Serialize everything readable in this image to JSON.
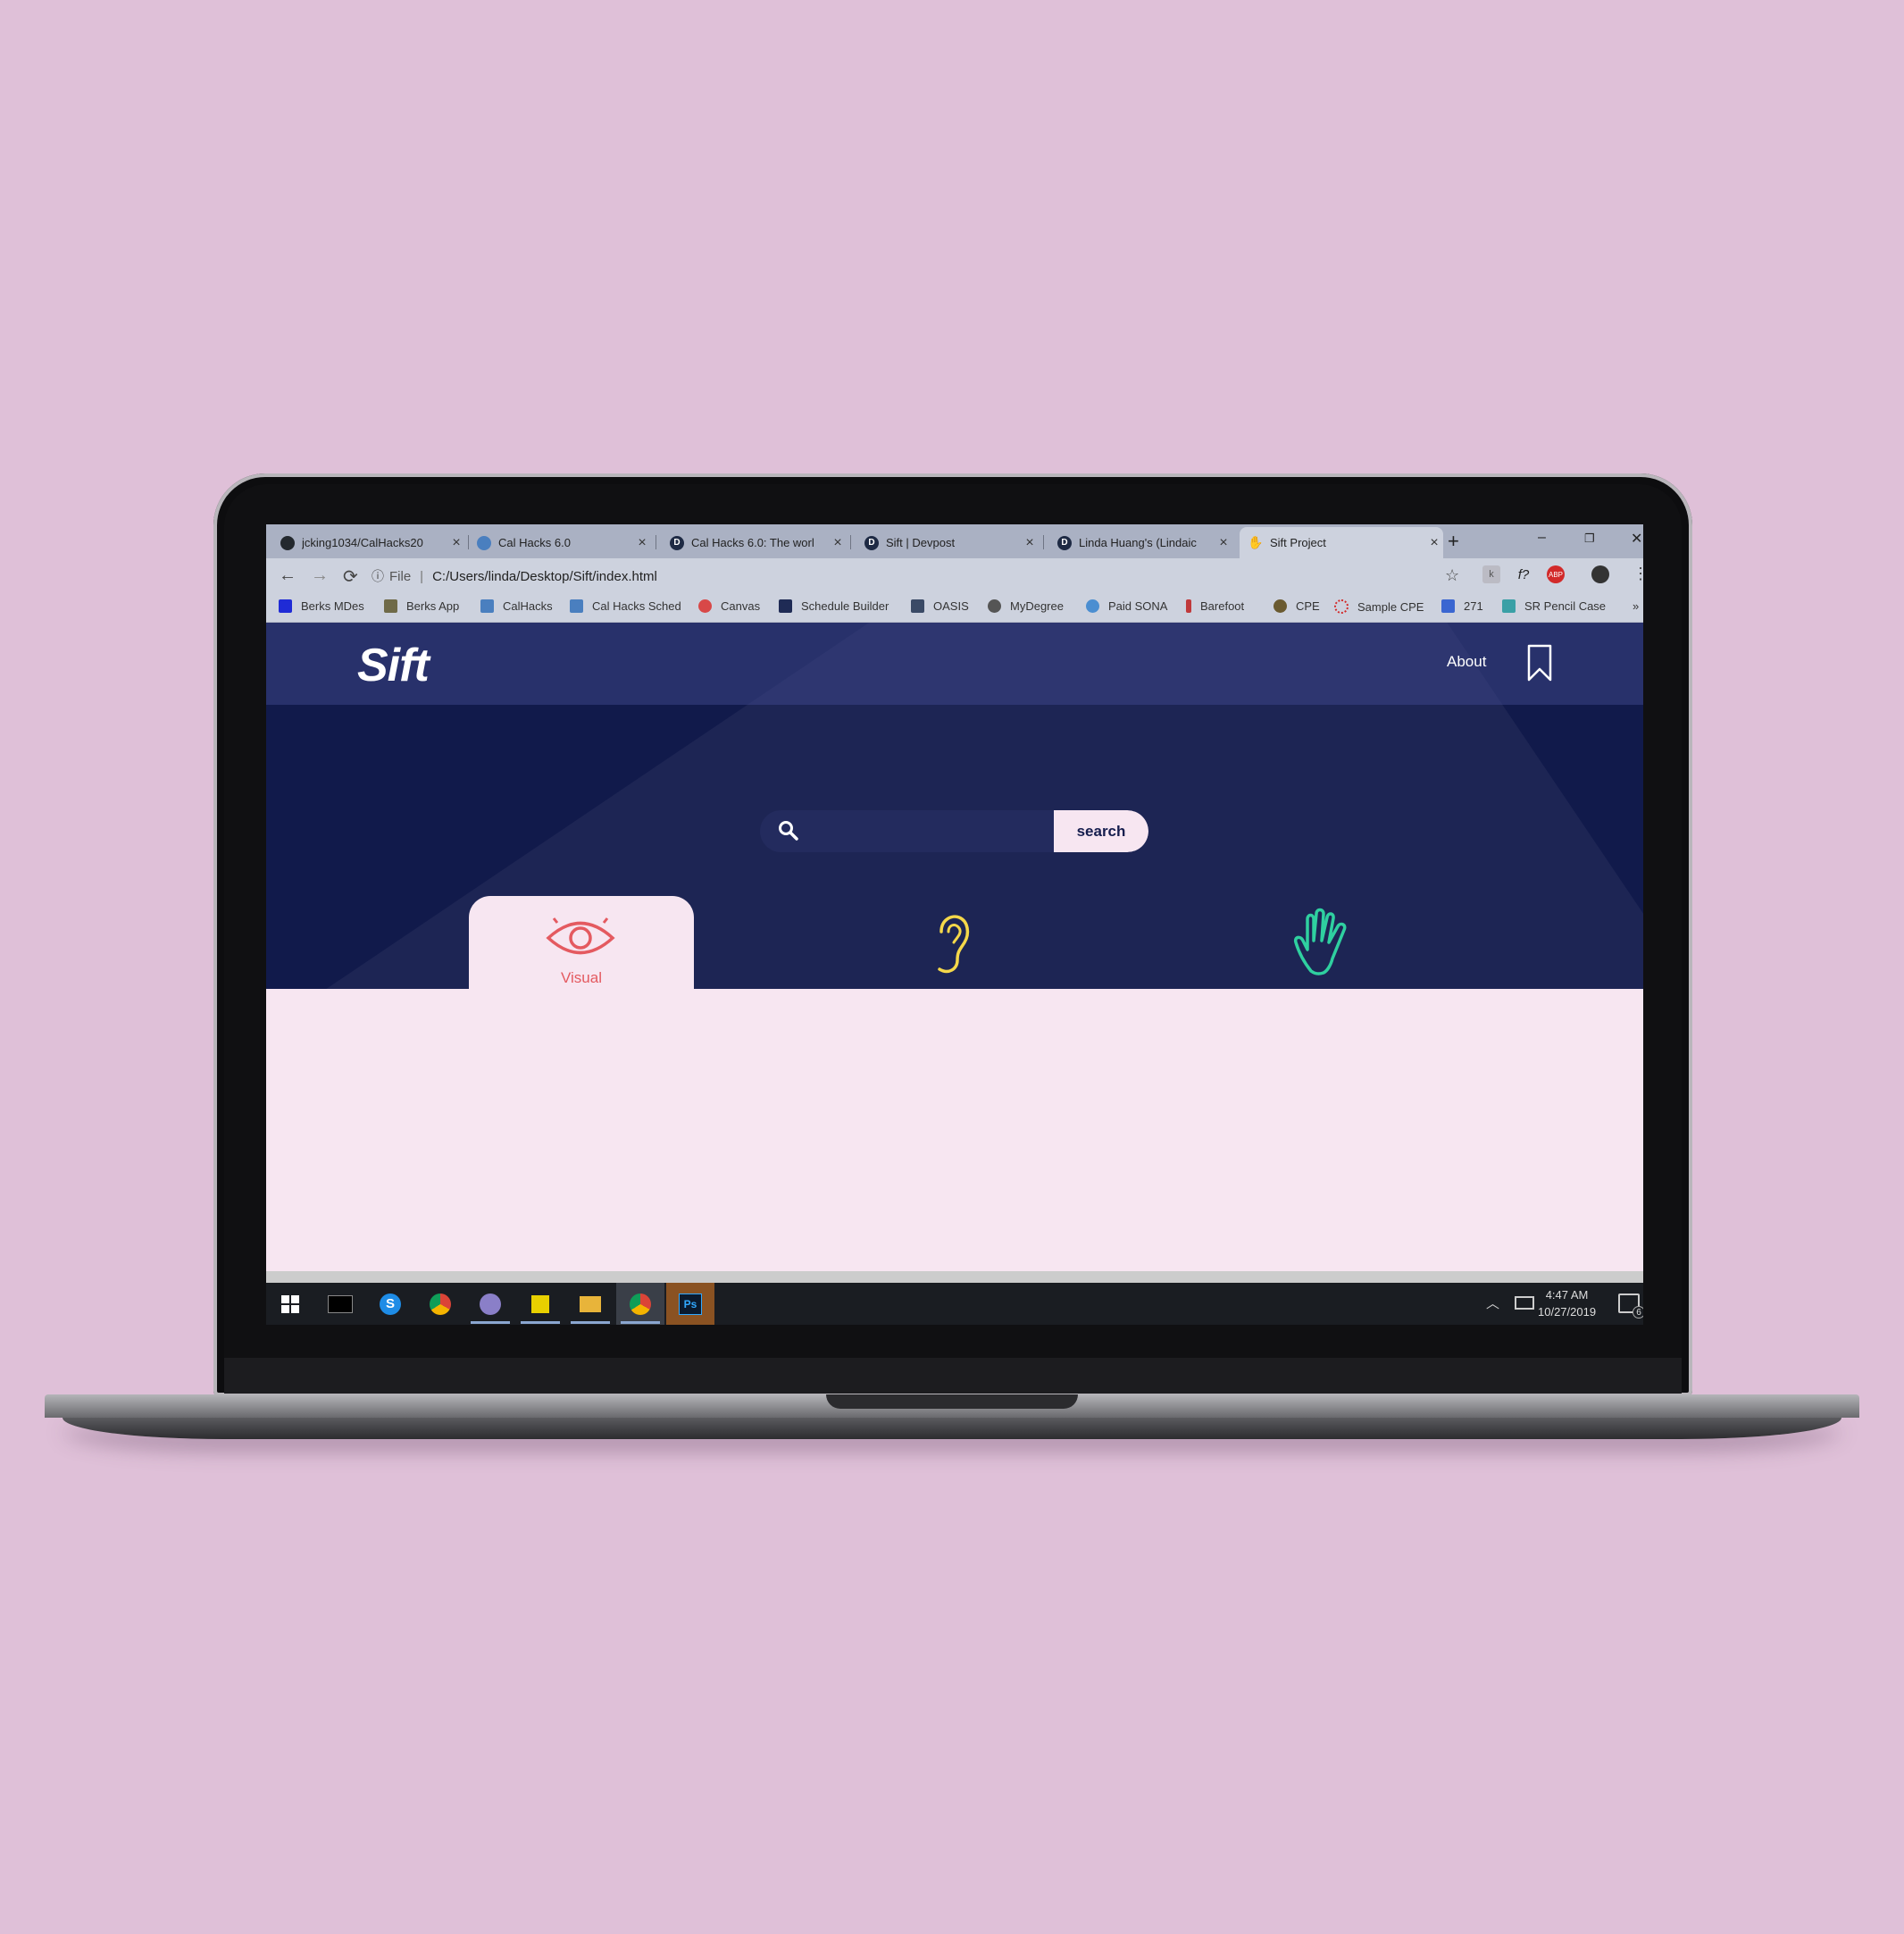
{
  "browser": {
    "tabs": [
      {
        "title": "jcking1034/CalHacks20",
        "icon": "github-icon"
      },
      {
        "title": "Cal Hacks 6.0",
        "icon": "calhacks-icon"
      },
      {
        "title": "Cal Hacks 6.0: The worl",
        "icon": "devpost-icon"
      },
      {
        "title": "Sift | Devpost",
        "icon": "devpost-icon"
      },
      {
        "title": "Linda Huang's (Lindaic",
        "icon": "devpost-icon"
      },
      {
        "title": "Sift Project",
        "icon": "hand-icon",
        "active": true
      }
    ],
    "new_tab_label": "+",
    "window_controls": {
      "minimize": "–",
      "restore": "❐",
      "close": "✕"
    },
    "address": {
      "scheme_label": "File",
      "url": "C:/Users/linda/Desktop/Sift/index.html"
    },
    "bookmarks": [
      {
        "label": "Berks MDes",
        "color": "#1f2bd6"
      },
      {
        "label": "Berks App",
        "color": "#6f6a48"
      },
      {
        "label": "CalHacks",
        "color": "#4a7fbf"
      },
      {
        "label": "Cal Hacks Sched",
        "color": "#4a7fbf"
      },
      {
        "label": "Canvas",
        "color": "#d84848"
      },
      {
        "label": "Schedule Builder",
        "color": "#1f2b55"
      },
      {
        "label": "OASIS",
        "color": "#3a4a66"
      },
      {
        "label": "MyDegree",
        "color": "#555555"
      },
      {
        "label": "Paid SONA",
        "color": "#4b8ed1"
      },
      {
        "label": "Barefoot",
        "color": "#c0393b"
      },
      {
        "label": "CPE",
        "color": "#6a5a30"
      },
      {
        "label": "Sample CPE",
        "color": "#d22a2a"
      },
      {
        "label": "271",
        "color": "#3a66d1"
      },
      {
        "label": "SR Pencil Case",
        "color": "#3aa0a6"
      }
    ],
    "bookmarks_overflow": "»",
    "extensions": {
      "formula": "f?",
      "adblock": "ABP"
    }
  },
  "site": {
    "logo": "Sift",
    "nav": {
      "about": "About"
    },
    "search": {
      "button_label": "search",
      "placeholder": ""
    },
    "categories": [
      {
        "label": "Visual",
        "icon": "eye-icon",
        "color": "#e45a60",
        "selected": true
      },
      {
        "label": "",
        "icon": "ear-icon",
        "color": "#f5d84a"
      },
      {
        "label": "",
        "icon": "hand-icon",
        "color": "#2fd0a0"
      }
    ],
    "colors": {
      "hero": "#111a4b",
      "panel": "#f7e6f1",
      "accent": "#e45a60"
    }
  },
  "taskbar": {
    "apps": [
      "windows-start-icon",
      "terminal-icon",
      "skype-icon",
      "chrome-icon",
      "paint-icon",
      "sticky-notes-icon",
      "file-explorer-icon",
      "chrome-icon",
      "photoshop-icon"
    ],
    "photoshop_label": "Ps",
    "skype_label": "S",
    "time": "4:47 AM",
    "date": "10/27/2019",
    "notification_count": "6"
  }
}
